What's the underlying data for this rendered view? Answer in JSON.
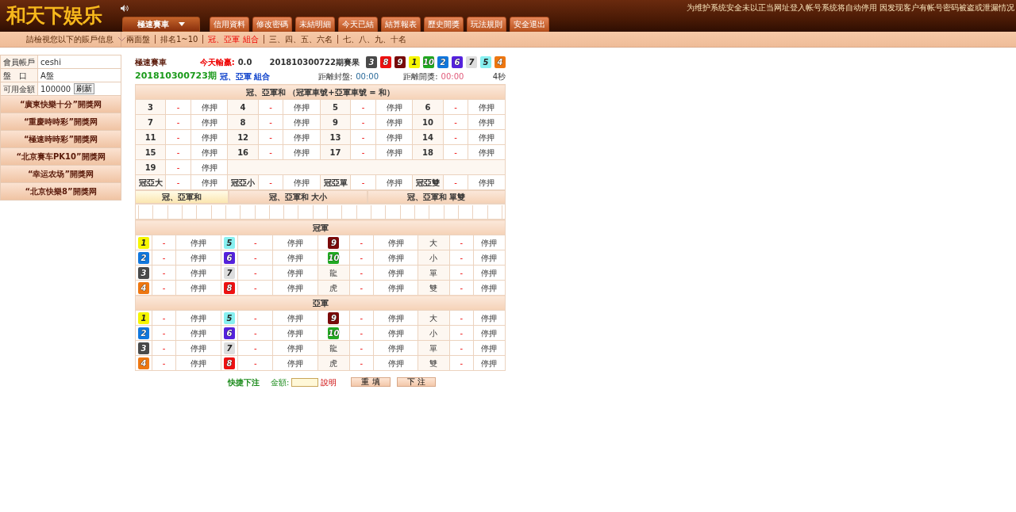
{
  "header": {
    "logo": "和天下娱乐",
    "notice": "为维护系统安全未以正当网址登入帐号系统将自动停用 因发现客户有帐号密码被盗或泄漏情况",
    "game_select": "極速賽車",
    "menu": [
      "信用資料",
      "修改密碼",
      "未結明細",
      "今天已結",
      "結算報表",
      "歷史開獎",
      "玩法規則",
      "安全退出"
    ]
  },
  "subnav": {
    "account_hint": "請檢視您以下的賬戶信息",
    "items": [
      {
        "label": "兩面盤",
        "selected": false
      },
      {
        "label": "排名1~10",
        "selected": false
      },
      {
        "label": "冠、亞軍 組合",
        "selected": true
      },
      {
        "label": "三、四、五、六名",
        "selected": false
      },
      {
        "label": "七、八、九、十名",
        "selected": false
      }
    ]
  },
  "account": [
    {
      "label": "會員帳戶",
      "value": "ceshi"
    },
    {
      "label": "盤　口",
      "value": "A盤"
    },
    {
      "label": "可用金額",
      "value": "100000",
      "button": "刷新"
    }
  ],
  "links": [
    "“廣東快樂十分”開獎网",
    "“重慶時時彩”開獎网",
    "“極速時時彩”開獎网",
    "“北京賽车PK10”開獎网",
    "“幸运农场”開獎网",
    "“北京快樂8”開獎网"
  ],
  "game": {
    "title": "極速賽車",
    "profit_label": "今天輸贏:",
    "profit": "0.0",
    "last_draw": "201810300722期賽果",
    "results": [
      {
        "number": "3",
        "color": "#4a4a4a"
      },
      {
        "number": "8",
        "color": "#ee1111"
      },
      {
        "number": "9",
        "color": "#7a0a0a"
      },
      {
        "number": "1",
        "color": "#f5f500"
      },
      {
        "number": "10",
        "color": "#22aa22"
      },
      {
        "number": "2",
        "color": "#1177dd"
      },
      {
        "number": "6",
        "color": "#5522dd"
      },
      {
        "number": "7",
        "color": "#dddddd"
      },
      {
        "number": "5",
        "color": "#88f0f0"
      },
      {
        "number": "4",
        "color": "#ee7711"
      }
    ],
    "period": "201810300723期",
    "play": "冠、亞軍 組合",
    "close_label": "距離封盤:",
    "close_time": "00:00",
    "draw_label": "距離開獎:",
    "draw_time": "00:00",
    "countdown": "4秒"
  },
  "sum_table": {
    "title": "冠、亞軍和 （冠軍車號+亞軍車號 = 和）",
    "rows": [
      [
        {
          "label": "3",
          "odds": "-",
          "status": "停押"
        },
        {
          "label": "4",
          "odds": "-",
          "status": "停押"
        },
        {
          "label": "5",
          "odds": "-",
          "status": "停押"
        },
        {
          "label": "6",
          "odds": "-",
          "status": "停押"
        }
      ],
      [
        {
          "label": "7",
          "odds": "-",
          "status": "停押"
        },
        {
          "label": "8",
          "odds": "-",
          "status": "停押"
        },
        {
          "label": "9",
          "odds": "-",
          "status": "停押"
        },
        {
          "label": "10",
          "odds": "-",
          "status": "停押"
        }
      ],
      [
        {
          "label": "11",
          "odds": "-",
          "status": "停押"
        },
        {
          "label": "12",
          "odds": "-",
          "status": "停押"
        },
        {
          "label": "13",
          "odds": "-",
          "status": "停押"
        },
        {
          "label": "14",
          "odds": "-",
          "status": "停押"
        }
      ],
      [
        {
          "label": "15",
          "odds": "-",
          "status": "停押"
        },
        {
          "label": "16",
          "odds": "-",
          "status": "停押"
        },
        {
          "label": "17",
          "odds": "-",
          "status": "停押"
        },
        {
          "label": "18",
          "odds": "-",
          "status": "停押"
        }
      ],
      [
        {
          "label": "19",
          "odds": "-",
          "status": "停押"
        }
      ],
      [
        {
          "label": "冠亞大",
          "odds": "-",
          "status": "停押"
        },
        {
          "label": "冠亞小",
          "odds": "-",
          "status": "停押"
        },
        {
          "label": "冠亞單",
          "odds": "-",
          "status": "停押"
        },
        {
          "label": "冠亞雙",
          "odds": "-",
          "status": "停押"
        }
      ]
    ]
  },
  "tabs": [
    {
      "label": "冠、亞軍和",
      "selected": true
    },
    {
      "label": "冠、亞軍和 大小",
      "selected": false
    },
    {
      "label": "冠、亞軍和 單雙",
      "selected": false
    }
  ],
  "sections": [
    {
      "title": "冠軍",
      "rows": [
        [
          {
            "kind": "ball",
            "label": "1",
            "color": "#f5f500",
            "odds": "-",
            "status": "停押"
          },
          {
            "kind": "ball",
            "label": "5",
            "color": "#88f0f0",
            "odds": "-",
            "status": "停押"
          },
          {
            "kind": "ball",
            "label": "9",
            "color": "#7a0a0a",
            "odds": "-",
            "status": "停押"
          },
          {
            "kind": "text",
            "label": "大",
            "odds": "-",
            "status": "停押"
          }
        ],
        [
          {
            "kind": "ball",
            "label": "2",
            "color": "#1177dd",
            "odds": "-",
            "status": "停押"
          },
          {
            "kind": "ball",
            "label": "6",
            "color": "#5522dd",
            "odds": "-",
            "status": "停押"
          },
          {
            "kind": "ball",
            "label": "10",
            "color": "#22aa22",
            "odds": "-",
            "status": "停押"
          },
          {
            "kind": "text",
            "label": "小",
            "odds": "-",
            "status": "停押"
          }
        ],
        [
          {
            "kind": "ball",
            "label": "3",
            "color": "#4a4a4a",
            "odds": "-",
            "status": "停押"
          },
          {
            "kind": "ball",
            "label": "7",
            "color": "#dddddd",
            "odds": "-",
            "status": "停押"
          },
          {
            "kind": "text",
            "label": "龍",
            "odds": "-",
            "status": "停押"
          },
          {
            "kind": "text",
            "label": "單",
            "odds": "-",
            "status": "停押"
          }
        ],
        [
          {
            "kind": "ball",
            "label": "4",
            "color": "#ee7711",
            "odds": "-",
            "status": "停押"
          },
          {
            "kind": "ball",
            "label": "8",
            "color": "#ee1111",
            "odds": "-",
            "status": "停押"
          },
          {
            "kind": "text",
            "label": "虎",
            "odds": "-",
            "status": "停押"
          },
          {
            "kind": "text",
            "label": "雙",
            "odds": "-",
            "status": "停押"
          }
        ]
      ]
    },
    {
      "title": "亞軍",
      "rows": [
        [
          {
            "kind": "ball",
            "label": "1",
            "color": "#f5f500",
            "odds": "-",
            "status": "停押"
          },
          {
            "kind": "ball",
            "label": "5",
            "color": "#88f0f0",
            "odds": "-",
            "status": "停押"
          },
          {
            "kind": "ball",
            "label": "9",
            "color": "#7a0a0a",
            "odds": "-",
            "status": "停押"
          },
          {
            "kind": "text",
            "label": "大",
            "odds": "-",
            "status": "停押"
          }
        ],
        [
          {
            "kind": "ball",
            "label": "2",
            "color": "#1177dd",
            "odds": "-",
            "status": "停押"
          },
          {
            "kind": "ball",
            "label": "6",
            "color": "#5522dd",
            "odds": "-",
            "status": "停押"
          },
          {
            "kind": "ball",
            "label": "10",
            "color": "#22aa22",
            "odds": "-",
            "status": "停押"
          },
          {
            "kind": "text",
            "label": "小",
            "odds": "-",
            "status": "停押"
          }
        ],
        [
          {
            "kind": "ball",
            "label": "3",
            "color": "#4a4a4a",
            "odds": "-",
            "status": "停押"
          },
          {
            "kind": "ball",
            "label": "7",
            "color": "#dddddd",
            "odds": "-",
            "status": "停押"
          },
          {
            "kind": "text",
            "label": "龍",
            "odds": "-",
            "status": "停押"
          },
          {
            "kind": "text",
            "label": "單",
            "odds": "-",
            "status": "停押"
          }
        ],
        [
          {
            "kind": "ball",
            "label": "4",
            "color": "#ee7711",
            "odds": "-",
            "status": "停押"
          },
          {
            "kind": "ball",
            "label": "8",
            "color": "#ee1111",
            "odds": "-",
            "status": "停押"
          },
          {
            "kind": "text",
            "label": "虎",
            "odds": "-",
            "status": "停押"
          },
          {
            "kind": "text",
            "label": "雙",
            "odds": "-",
            "status": "停押"
          }
        ]
      ]
    }
  ],
  "quick_bet": {
    "label": "快捷下注",
    "amount_label": "金額:",
    "help": "說明",
    "reset": "重 填",
    "submit": "下 注"
  }
}
